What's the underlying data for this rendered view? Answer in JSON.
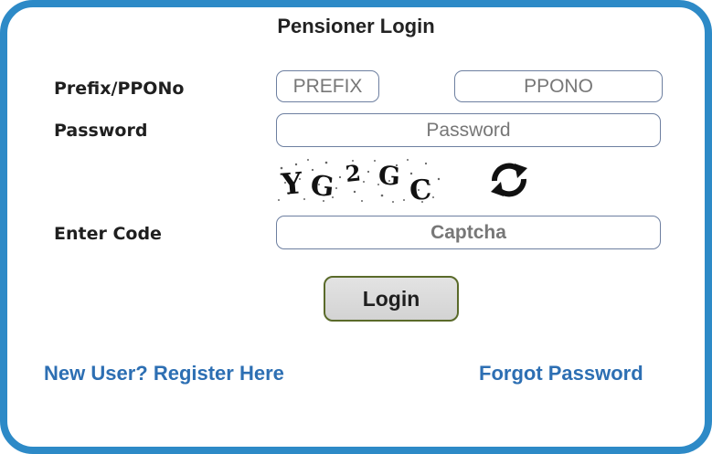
{
  "form": {
    "title": "Pensioner Login",
    "prefix_label": "Prefix/PPONo",
    "prefix_placeholder": "PREFIX",
    "ppono_placeholder": "PPONO",
    "password_label": "Password",
    "password_placeholder": "Password",
    "captcha_text": "YG2GC",
    "captcha_label": "Enter Code",
    "captcha_placeholder": "Captcha",
    "login_label": "Login",
    "register_link": "New User? Register Here",
    "forgot_link": "Forgot Password"
  },
  "icons": {
    "refresh": "refresh-icon"
  },
  "colors": {
    "border": "#2d8ac7",
    "link": "#2d6fb3"
  }
}
